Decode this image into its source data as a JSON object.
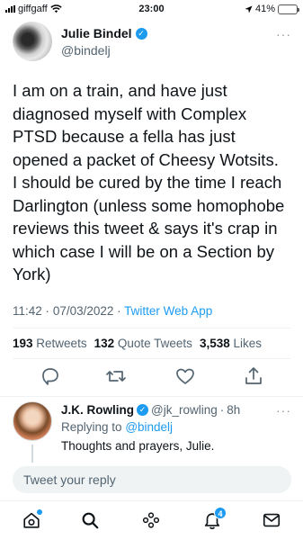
{
  "status_bar": {
    "carrier": "giffgaff",
    "time": "23:00",
    "battery_percent": "41%",
    "battery_level": 0.41,
    "icons": [
      "signal-icon",
      "wifi-icon",
      "location-arrow-icon",
      "battery-charging-icon"
    ]
  },
  "tweet": {
    "author_name": "Julie Bindel",
    "author_handle": "@bindelj",
    "verified": true,
    "text_lines": [
      "I am on a train, and have just",
      "diagnosed myself with Complex",
      "PTSD because a fella has just",
      "opened a packet of Cheesy Wotsits.",
      "I should be cured by the time I reach",
      "Darlington (unless some homophobe",
      "reviews this tweet & says it's crap in",
      "which case I will be on a Section by",
      "York)"
    ],
    "time": "11:42",
    "date": "07/03/2022",
    "source": "Twitter Web App",
    "separator": "·"
  },
  "stats": {
    "retweets_count": "193",
    "retweets_label": "Retweets",
    "quote_count": "132",
    "quote_label": "Quote Tweets",
    "likes_count": "3,538",
    "likes_label": "Likes"
  },
  "reply": {
    "author_name": "J.K. Rowling",
    "author_handle": "@jk_rowling",
    "separator": "·",
    "age": "8h",
    "verified": true,
    "replying_prefix": "Replying to",
    "replying_to": "@bindelj",
    "text": "Thoughts and prayers, Julie."
  },
  "composer": {
    "placeholder": "Tweet your reply"
  },
  "bottom_nav": {
    "notifications_badge": "4",
    "items": [
      "home-icon",
      "search-icon",
      "spaces-icon",
      "notifications-icon",
      "messages-icon"
    ]
  },
  "colors": {
    "accent": "#1d9bf0",
    "text": "#0f1419",
    "secondary": "#536471",
    "divider": "#eff3f4"
  }
}
